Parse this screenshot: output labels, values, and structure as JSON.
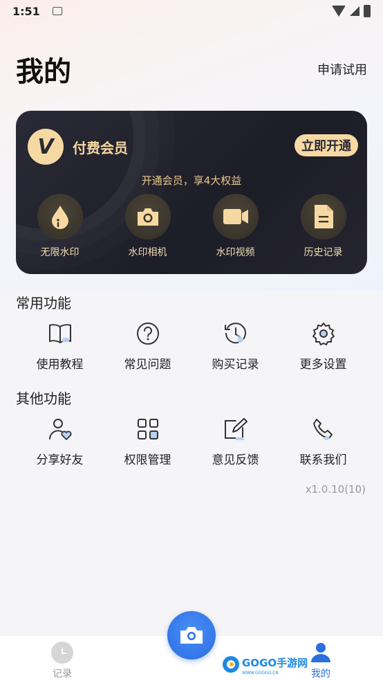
{
  "status_bar": {
    "time": "1:51"
  },
  "header": {
    "title": "我的",
    "trial_link": "申请试用"
  },
  "vip_card": {
    "logo_letter": "V",
    "title": "付费会员",
    "open_button": "立即开通",
    "subtitle": "开通会员，享4大权益",
    "benefits": [
      {
        "label": "无限水印",
        "icon": "water-drop-icon"
      },
      {
        "label": "水印相机",
        "icon": "camera-icon"
      },
      {
        "label": "水印视频",
        "icon": "video-camera-icon"
      },
      {
        "label": "历史记录",
        "icon": "document-icon"
      }
    ]
  },
  "common_functions": {
    "title": "常用功能",
    "items": [
      {
        "label": "使用教程",
        "icon": "book-icon"
      },
      {
        "label": "常见问题",
        "icon": "question-icon"
      },
      {
        "label": "购买记录",
        "icon": "history-clock-icon"
      },
      {
        "label": "更多设置",
        "icon": "gear-icon"
      }
    ]
  },
  "other_functions": {
    "title": "其他功能",
    "items": [
      {
        "label": "分享好友",
        "icon": "share-user-icon"
      },
      {
        "label": "权限管理",
        "icon": "grid-icon"
      },
      {
        "label": "意见反馈",
        "icon": "edit-icon"
      },
      {
        "label": "联系我们",
        "icon": "phone-icon"
      }
    ]
  },
  "version": "x1.0.10(10)",
  "tab_bar": {
    "tabs": [
      {
        "label": "记录",
        "icon": "clock-icon",
        "active": false
      },
      {
        "label": "我的",
        "icon": "user-icon",
        "active": true
      }
    ]
  },
  "watermark": {
    "text": "GOGO手游网",
    "url_text": "WWW.GOGGO.CN"
  },
  "colors": {
    "accent": "#2b6fe0",
    "gold": "#f6d9a2",
    "card_bg": "#1d1d27"
  }
}
